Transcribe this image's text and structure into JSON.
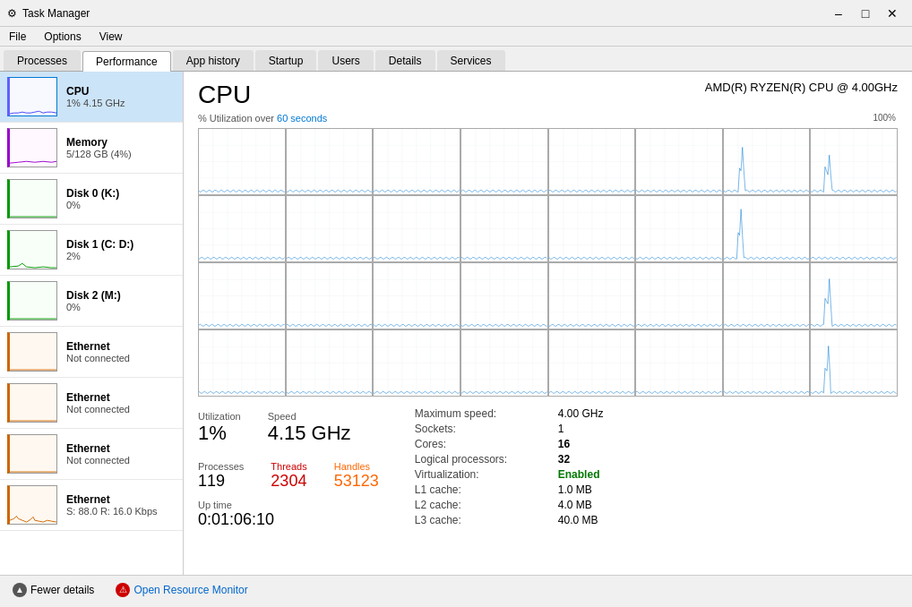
{
  "window": {
    "title": "Task Manager",
    "icon": "⚙"
  },
  "menu": {
    "items": [
      "File",
      "Options",
      "View"
    ]
  },
  "tabs": [
    {
      "id": "processes",
      "label": "Processes"
    },
    {
      "id": "performance",
      "label": "Performance",
      "active": true
    },
    {
      "id": "app-history",
      "label": "App history"
    },
    {
      "id": "startup",
      "label": "Startup"
    },
    {
      "id": "users",
      "label": "Users"
    },
    {
      "id": "details",
      "label": "Details"
    },
    {
      "id": "services",
      "label": "Services"
    }
  ],
  "sidebar": {
    "items": [
      {
        "id": "cpu",
        "label": "CPU",
        "sublabel": "1% 4.15 GHz",
        "active": true,
        "graph_type": "cpu"
      },
      {
        "id": "memory",
        "label": "Memory",
        "sublabel": "5/128 GB (4%)",
        "graph_type": "mem"
      },
      {
        "id": "disk0",
        "label": "Disk 0 (K:)",
        "sublabel": "0%",
        "graph_type": "disk0"
      },
      {
        "id": "disk1",
        "label": "Disk 1 (C: D:)",
        "sublabel": "2%",
        "graph_type": "disk1"
      },
      {
        "id": "disk2",
        "label": "Disk 2 (M:)",
        "sublabel": "0%",
        "graph_type": "disk2"
      },
      {
        "id": "eth1",
        "label": "Ethernet",
        "sublabel": "Not connected",
        "graph_type": "eth1"
      },
      {
        "id": "eth2",
        "label": "Ethernet",
        "sublabel": "Not connected",
        "graph_type": "eth2"
      },
      {
        "id": "eth3",
        "label": "Ethernet",
        "sublabel": "Not connected",
        "graph_type": "eth3"
      },
      {
        "id": "eth4",
        "label": "Ethernet",
        "sublabel": "S: 88.0  R: 16.0 Kbps",
        "graph_type": "eth4",
        "has_activity": true
      }
    ]
  },
  "cpu": {
    "title": "CPU",
    "subtitle": "AMD(R) RYZEN(R) CPU @ 4.00GHz",
    "utilization_text": "% Utilization over 60 seconds",
    "utilization_seconds": "60",
    "percent_100": "100%",
    "utilization": "1%",
    "utilization_label": "Utilization",
    "speed": "4.15 GHz",
    "speed_label": "Speed",
    "processes": "119",
    "processes_label": "Processes",
    "threads": "2304",
    "threads_label": "Threads",
    "handles": "53123",
    "handles_label": "Handles",
    "uptime": "0:01:06:10",
    "uptime_label": "Up time",
    "max_speed_label": "Maximum speed:",
    "max_speed": "4.00 GHz",
    "sockets_label": "Sockets:",
    "sockets": "1",
    "cores_label": "Cores:",
    "cores": "16",
    "logical_label": "Logical processors:",
    "logical": "32",
    "virt_label": "Virtualization:",
    "virt": "Enabled",
    "l1_label": "L1 cache:",
    "l1": "1.0 MB",
    "l2_label": "L2 cache:",
    "l2": "4.0 MB",
    "l3_label": "L3 cache:",
    "l3": "40.0 MB"
  },
  "bottom": {
    "fewer_label": "Fewer details",
    "monitor_label": "Open Resource Monitor"
  }
}
